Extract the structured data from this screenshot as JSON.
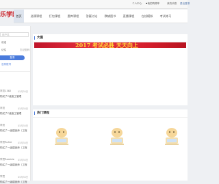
{
  "topbar": {
    "welcome": "个人中心",
    "cart": "我的购物车",
    "messages": "我的消息",
    "logout": "退出登录",
    "accent_color": "#4a6fa8"
  },
  "logo": {
    "text": "乐学网"
  },
  "nav": {
    "items": [
      "首页",
      "选课课程",
      "打包课程",
      "题库课程",
      "答疑讨论",
      "教辅图书",
      "直播课程",
      "在线模拟",
      "考试练习"
    ],
    "active_index": 0
  },
  "sidebar": {
    "search_placeholder": "用户名",
    "welcome_text": "欢迎",
    "forgot_text": "忘记密码",
    "remember_text": "记住",
    "login_button": "登录",
    "register_link": "没有账号",
    "records": [
      {
        "title": "学员1382",
        "date": "05月30日",
        "sub": "购买了C级施工管理"
      },
      {
        "title": "学员",
        "date": "05月30日",
        "sub": "购买了C级施工管理"
      },
      {
        "title": "学员",
        "date": "05月30日",
        "sub": "购买了一级建造师（工程"
      },
      {
        "title": "学员Ruhle",
        "date": "05月30日",
        "sub": "购买了一级建造师（工程"
      },
      {
        "title": "学员Ramide",
        "date": "05月30日",
        "sub": "购买了一级建造师（工程"
      },
      {
        "title": "学员",
        "date": "05月30日",
        "sub": "购买了一级建造师（工程"
      }
    ]
  },
  "banner_panel": {
    "title": "大图",
    "banner_text": "2017 考试必胜 天天向上"
  },
  "hot_panel": {
    "title": "热门课程",
    "cards": [
      "course-1",
      "course-2",
      "course-3"
    ]
  }
}
